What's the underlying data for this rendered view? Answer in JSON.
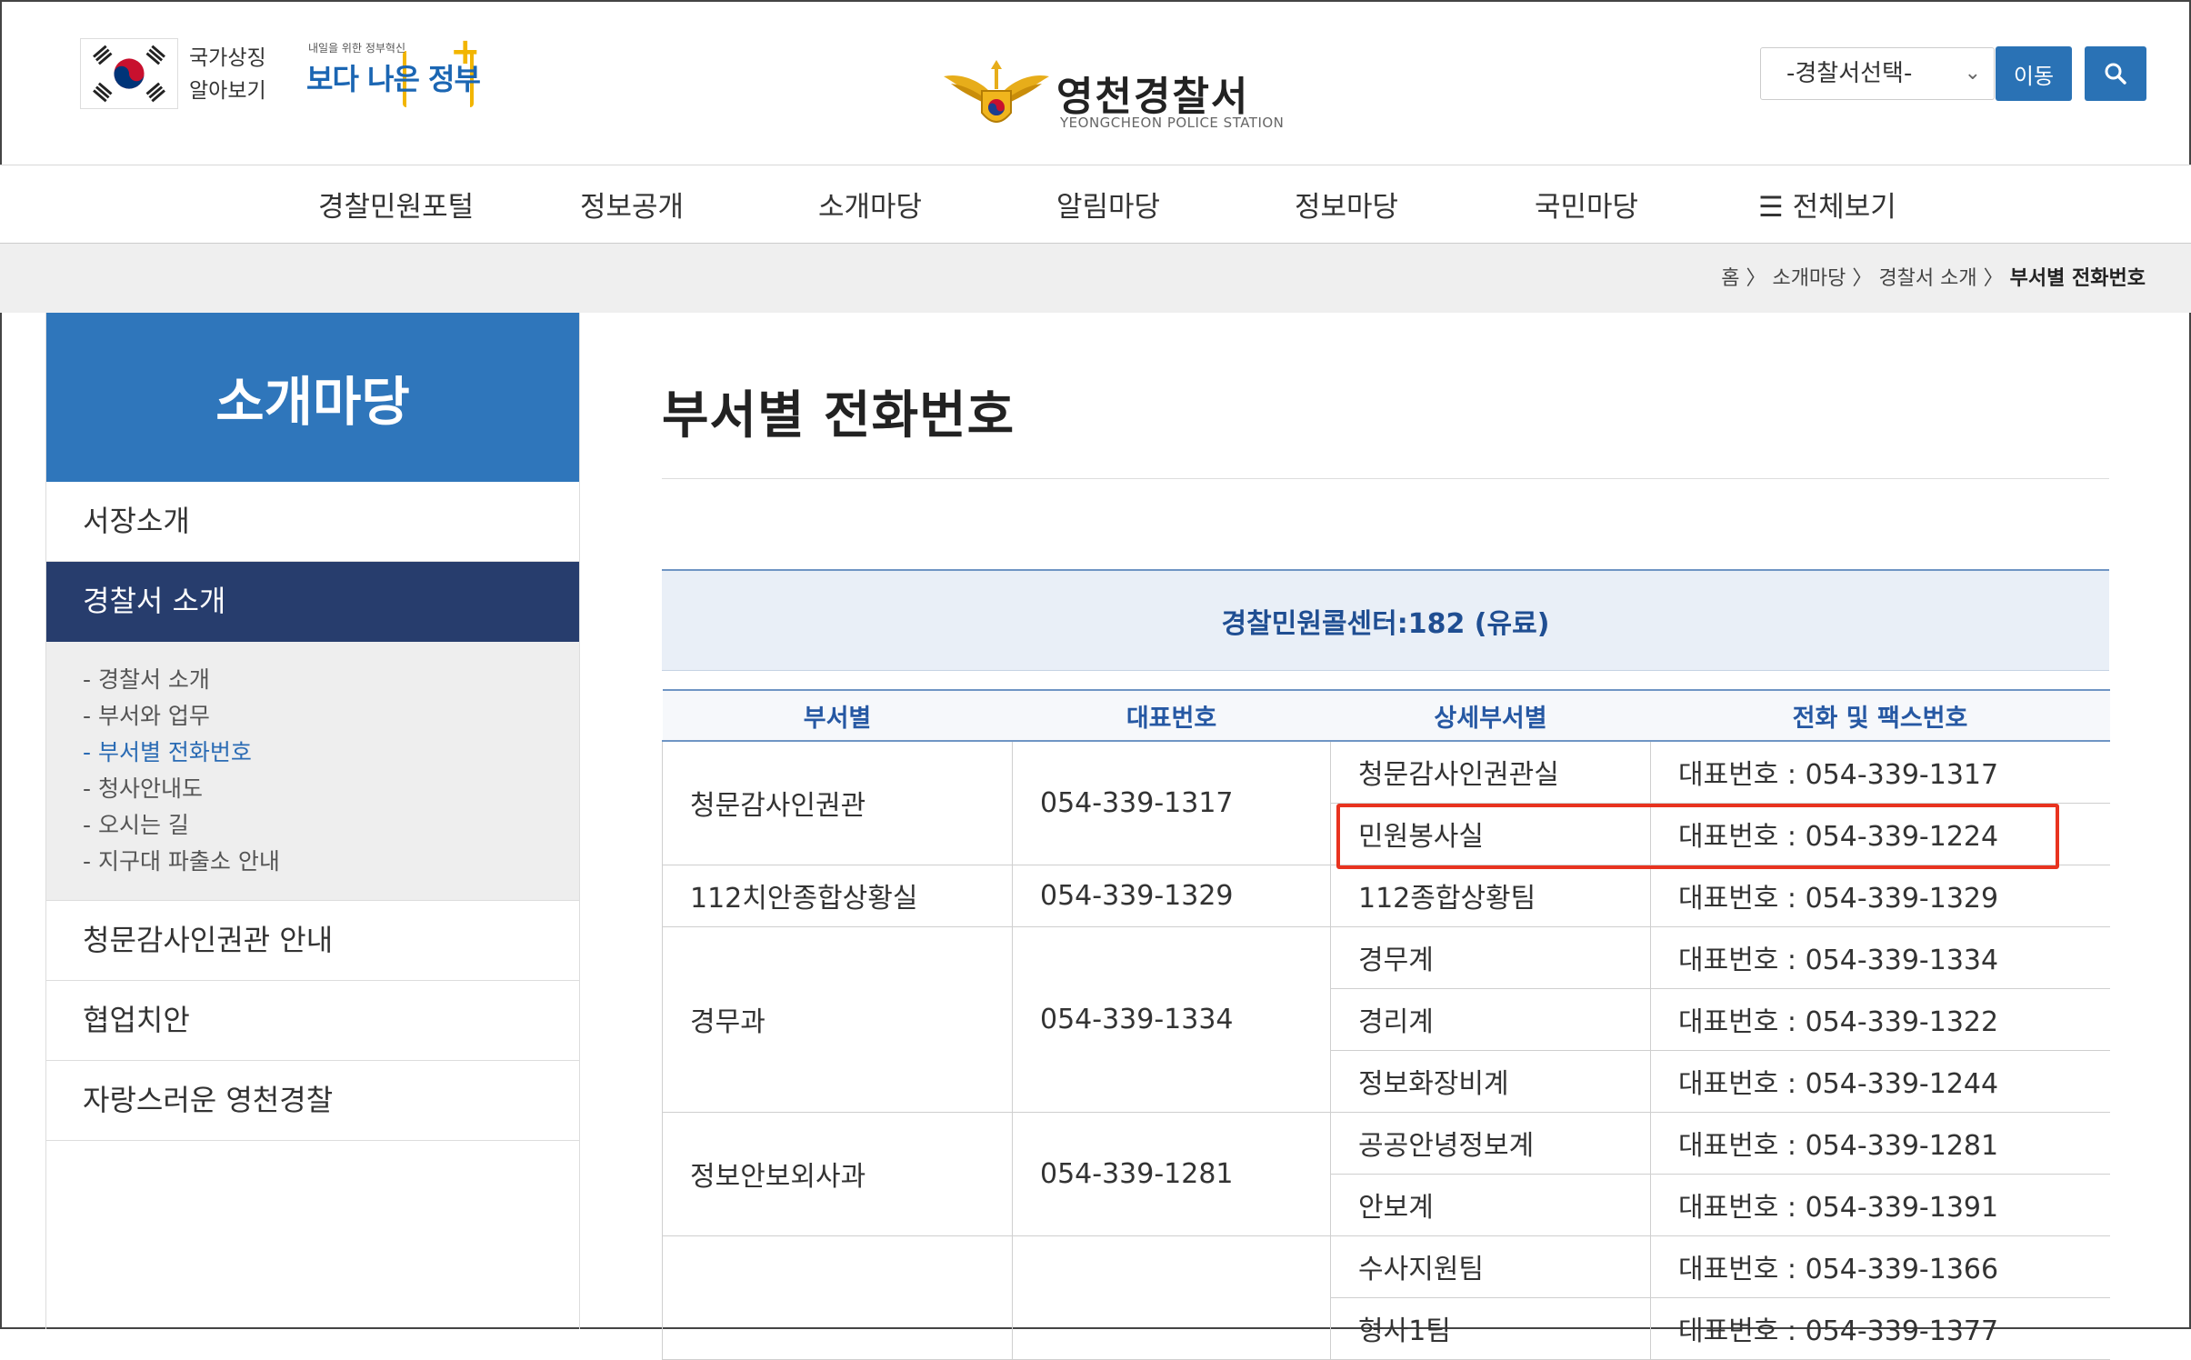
{
  "header": {
    "symbol_label_line1": "국가상징",
    "symbol_label_line2": "알아보기",
    "gov_slogan_small": "내일을 위한 정부혁신",
    "gov_slogan_big_a": "보다 나은",
    "gov_slogan_big_b": "정부",
    "brand_name": "영천경찰서",
    "brand_name_en": "YEONGCHEON POLICE STATION",
    "station_select_value": "-경찰서선택-",
    "move_button": "이동"
  },
  "gnb": [
    "경찰민원포털",
    "정보공개",
    "소개마당",
    "알림마당",
    "정보마당",
    "국민마당",
    "전체보기"
  ],
  "breadcrumb": {
    "home": "홈",
    "level1": "소개마당",
    "level2": "경찰서 소개",
    "current": "부서별 전화번호",
    "sep": "〉"
  },
  "sidebar": {
    "title": "소개마당",
    "items": [
      "서장소개",
      "경찰서 소개",
      "청문감사인권관 안내",
      "협업치안",
      "자랑스러운 영천경찰"
    ],
    "sub_items": [
      "경찰서 소개",
      "부서와 업무",
      "부서별 전화번호",
      "청사안내도",
      "오시는 길",
      "지구대 파출소 안내"
    ],
    "sub_bullet": "-"
  },
  "content": {
    "title": "부서별 전화번호",
    "call_center": "경찰민원콜센터:182 (유료)",
    "table_headers": [
      "부서별",
      "대표번호",
      "상세부서별",
      "전화 및 팩스번호"
    ],
    "rows": [
      {
        "dept": "청문감사인권관",
        "main": "054-339-1317",
        "subs": [
          {
            "name": "청문감사인권관실",
            "phone": "대표번호 : 054-339-1317"
          },
          {
            "name": "민원봉사실",
            "phone": "대표번호 : 054-339-1224"
          }
        ]
      },
      {
        "dept": "112치안종합상황실",
        "main": "054-339-1329",
        "subs": [
          {
            "name": "112종합상황팀",
            "phone": "대표번호 : 054-339-1329"
          }
        ]
      },
      {
        "dept": "경무과",
        "main": "054-339-1334",
        "subs": [
          {
            "name": "경무계",
            "phone": "대표번호 : 054-339-1334"
          },
          {
            "name": "경리계",
            "phone": "대표번호 : 054-339-1322"
          },
          {
            "name": "정보화장비계",
            "phone": "대표번호 : 054-339-1244"
          }
        ]
      },
      {
        "dept": "정보안보외사과",
        "main": "054-339-1281",
        "subs": [
          {
            "name": "공공안녕정보계",
            "phone": "대표번호 : 054-339-1281"
          },
          {
            "name": "안보계",
            "phone": "대표번호 : 054-339-1391"
          }
        ]
      },
      {
        "dept": "",
        "main": "",
        "subs": [
          {
            "name": "수사지원팀",
            "phone": "대표번호 : 054-339-1366"
          },
          {
            "name": "형사1팀",
            "phone": "대표번호 : 054-339-1377"
          }
        ]
      }
    ]
  },
  "colors": {
    "accent_blue": "#2f76bb",
    "active_navy": "#273d6d",
    "highlight_red": "#e8331f"
  }
}
